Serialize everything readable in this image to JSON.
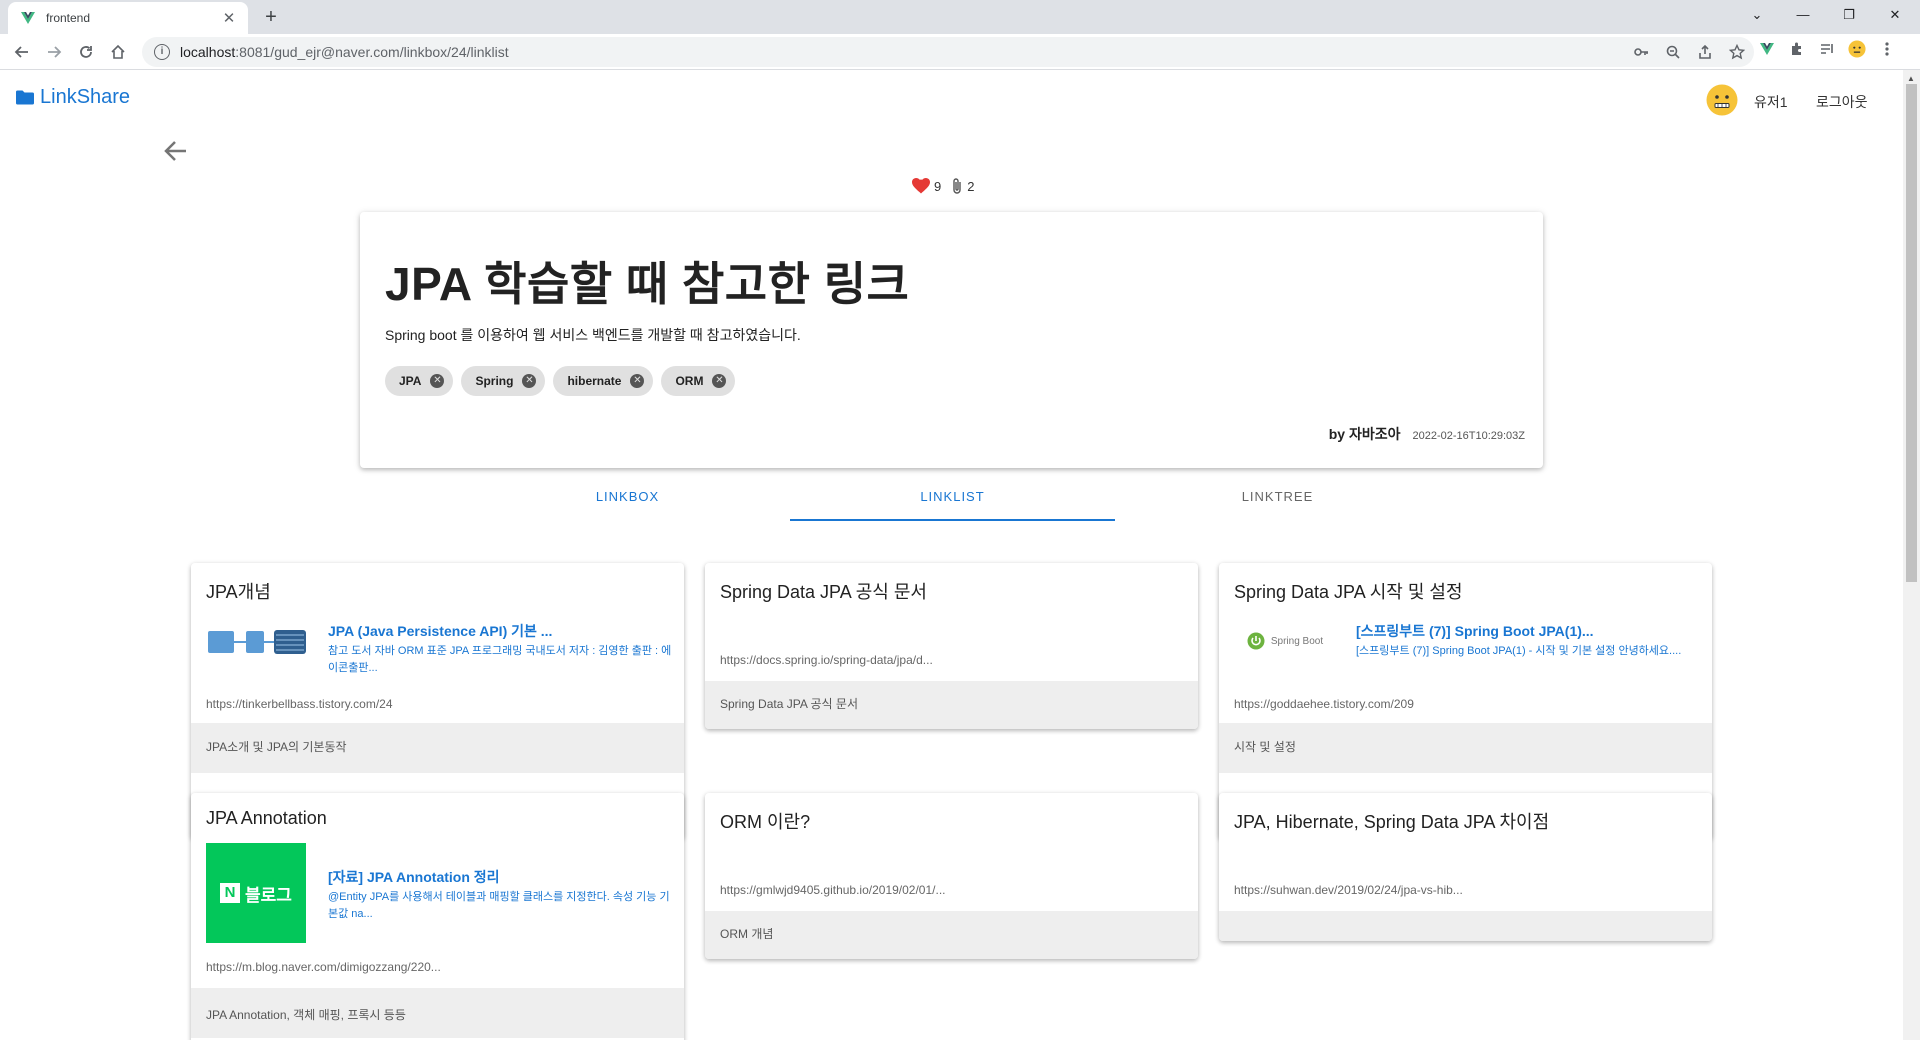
{
  "browser": {
    "tab_title": "frontend",
    "url_host": "localhost",
    "url_path": ":8081/gud_ejr@naver.com/linkbox/24/linklist"
  },
  "header": {
    "logo_text": "LinkShare",
    "user_name": "유저1",
    "logout_label": "로그아웃"
  },
  "linkbox": {
    "likes": "9",
    "link_count": "2",
    "title": "JPA 학습할 때 참고한 링크",
    "description": "Spring boot 를 이용하여 웹 서비스 백엔드를 개발할 때 참고하였습니다.",
    "tags": [
      "JPA",
      "Spring",
      "hibernate",
      "ORM"
    ],
    "author": "by 자바조아",
    "date": "2022-02-16T10:29:03Z"
  },
  "tabs": [
    {
      "label": "LINKBOX"
    },
    {
      "label": "LINKLIST",
      "active": true
    },
    {
      "label": "LINKTREE"
    }
  ],
  "links": [
    {
      "title": "JPA개념",
      "preview_title": "JPA (Java Persistence API) 기본 ...",
      "preview_desc": "참고 도서 자바 ORM 표준 JPA 프로그래밍 국내도서 저자 : 김영한 출판 : 에이콘출판...",
      "url": "https://tinkerbellbass.tistory.com/24",
      "memo": "JPA소개 및 JPA의 기본동작"
    },
    {
      "title": "Spring Data JPA 공식 문서",
      "url": "https://docs.spring.io/spring-data/jpa/d...",
      "memo": "Spring Data JPA 공식 문서"
    },
    {
      "title": "Spring Data JPA 시작 및 설정",
      "preview_title": "[스프링부트 (7)] Spring Boot JPA(1)...",
      "preview_desc": "[스프링부트 (7)] Spring Boot JPA(1) - 시작 및 기본 설정 안녕하세요....",
      "thumb_text": "Spring Boot",
      "url": "https://goddaehee.tistory.com/209",
      "memo": "시작 및 설정"
    },
    {
      "title": "JPA Annotation",
      "preview_title": "[자료] JPA Annotation 정리",
      "preview_desc": "@Entity JPA를 사용해서 테이블과 매핑할 클래스를 지정한다. 속성 기능 기본값 na...",
      "thumb_text": "블로그",
      "url": "https://m.blog.naver.com/dimigozzang/220...",
      "memo": "JPA Annotation, 객체 매핑, 프록시 등등"
    },
    {
      "title": "ORM 이란?",
      "url": "https://gmlwjd9405.github.io/2019/02/01/...",
      "memo": "ORM 개념"
    },
    {
      "title": "JPA, Hibernate, Spring Data JPA 차이점",
      "url": "https://suhwan.dev/2019/02/24/jpa-vs-hib...",
      "memo": ""
    }
  ],
  "colors": {
    "accent": "#1976d2",
    "heart": "#e53935",
    "naver_green": "#03c75a",
    "spring_green": "#6db33f"
  }
}
